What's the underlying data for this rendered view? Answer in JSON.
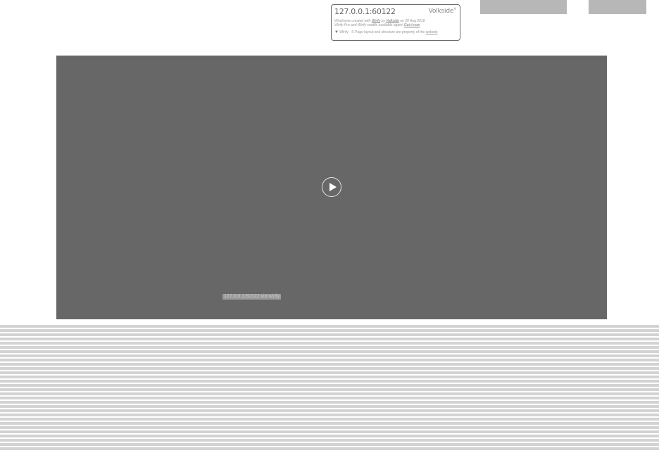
{
  "card": {
    "host": "127.0.0.1:60122",
    "brand": "Volkside",
    "line1_prefix": "Wireframe created with ",
    "line1_link1": "Wirify",
    "line1_mid": " by ",
    "line1_link2": "Volkside",
    "line1_suffix": " on 20 Aug 2018",
    "line2_prefix": "Wirify Pro and Wirify credits available again! ",
    "line2_link": "Get it now",
    "footer_tri": "▼",
    "footer_label": "Wirify",
    "footer_copy": "© Page layout and structure are property of the ",
    "footer_link": "website"
  },
  "video": {
    "caption": "127.0.0.1:60122 via wirify"
  }
}
